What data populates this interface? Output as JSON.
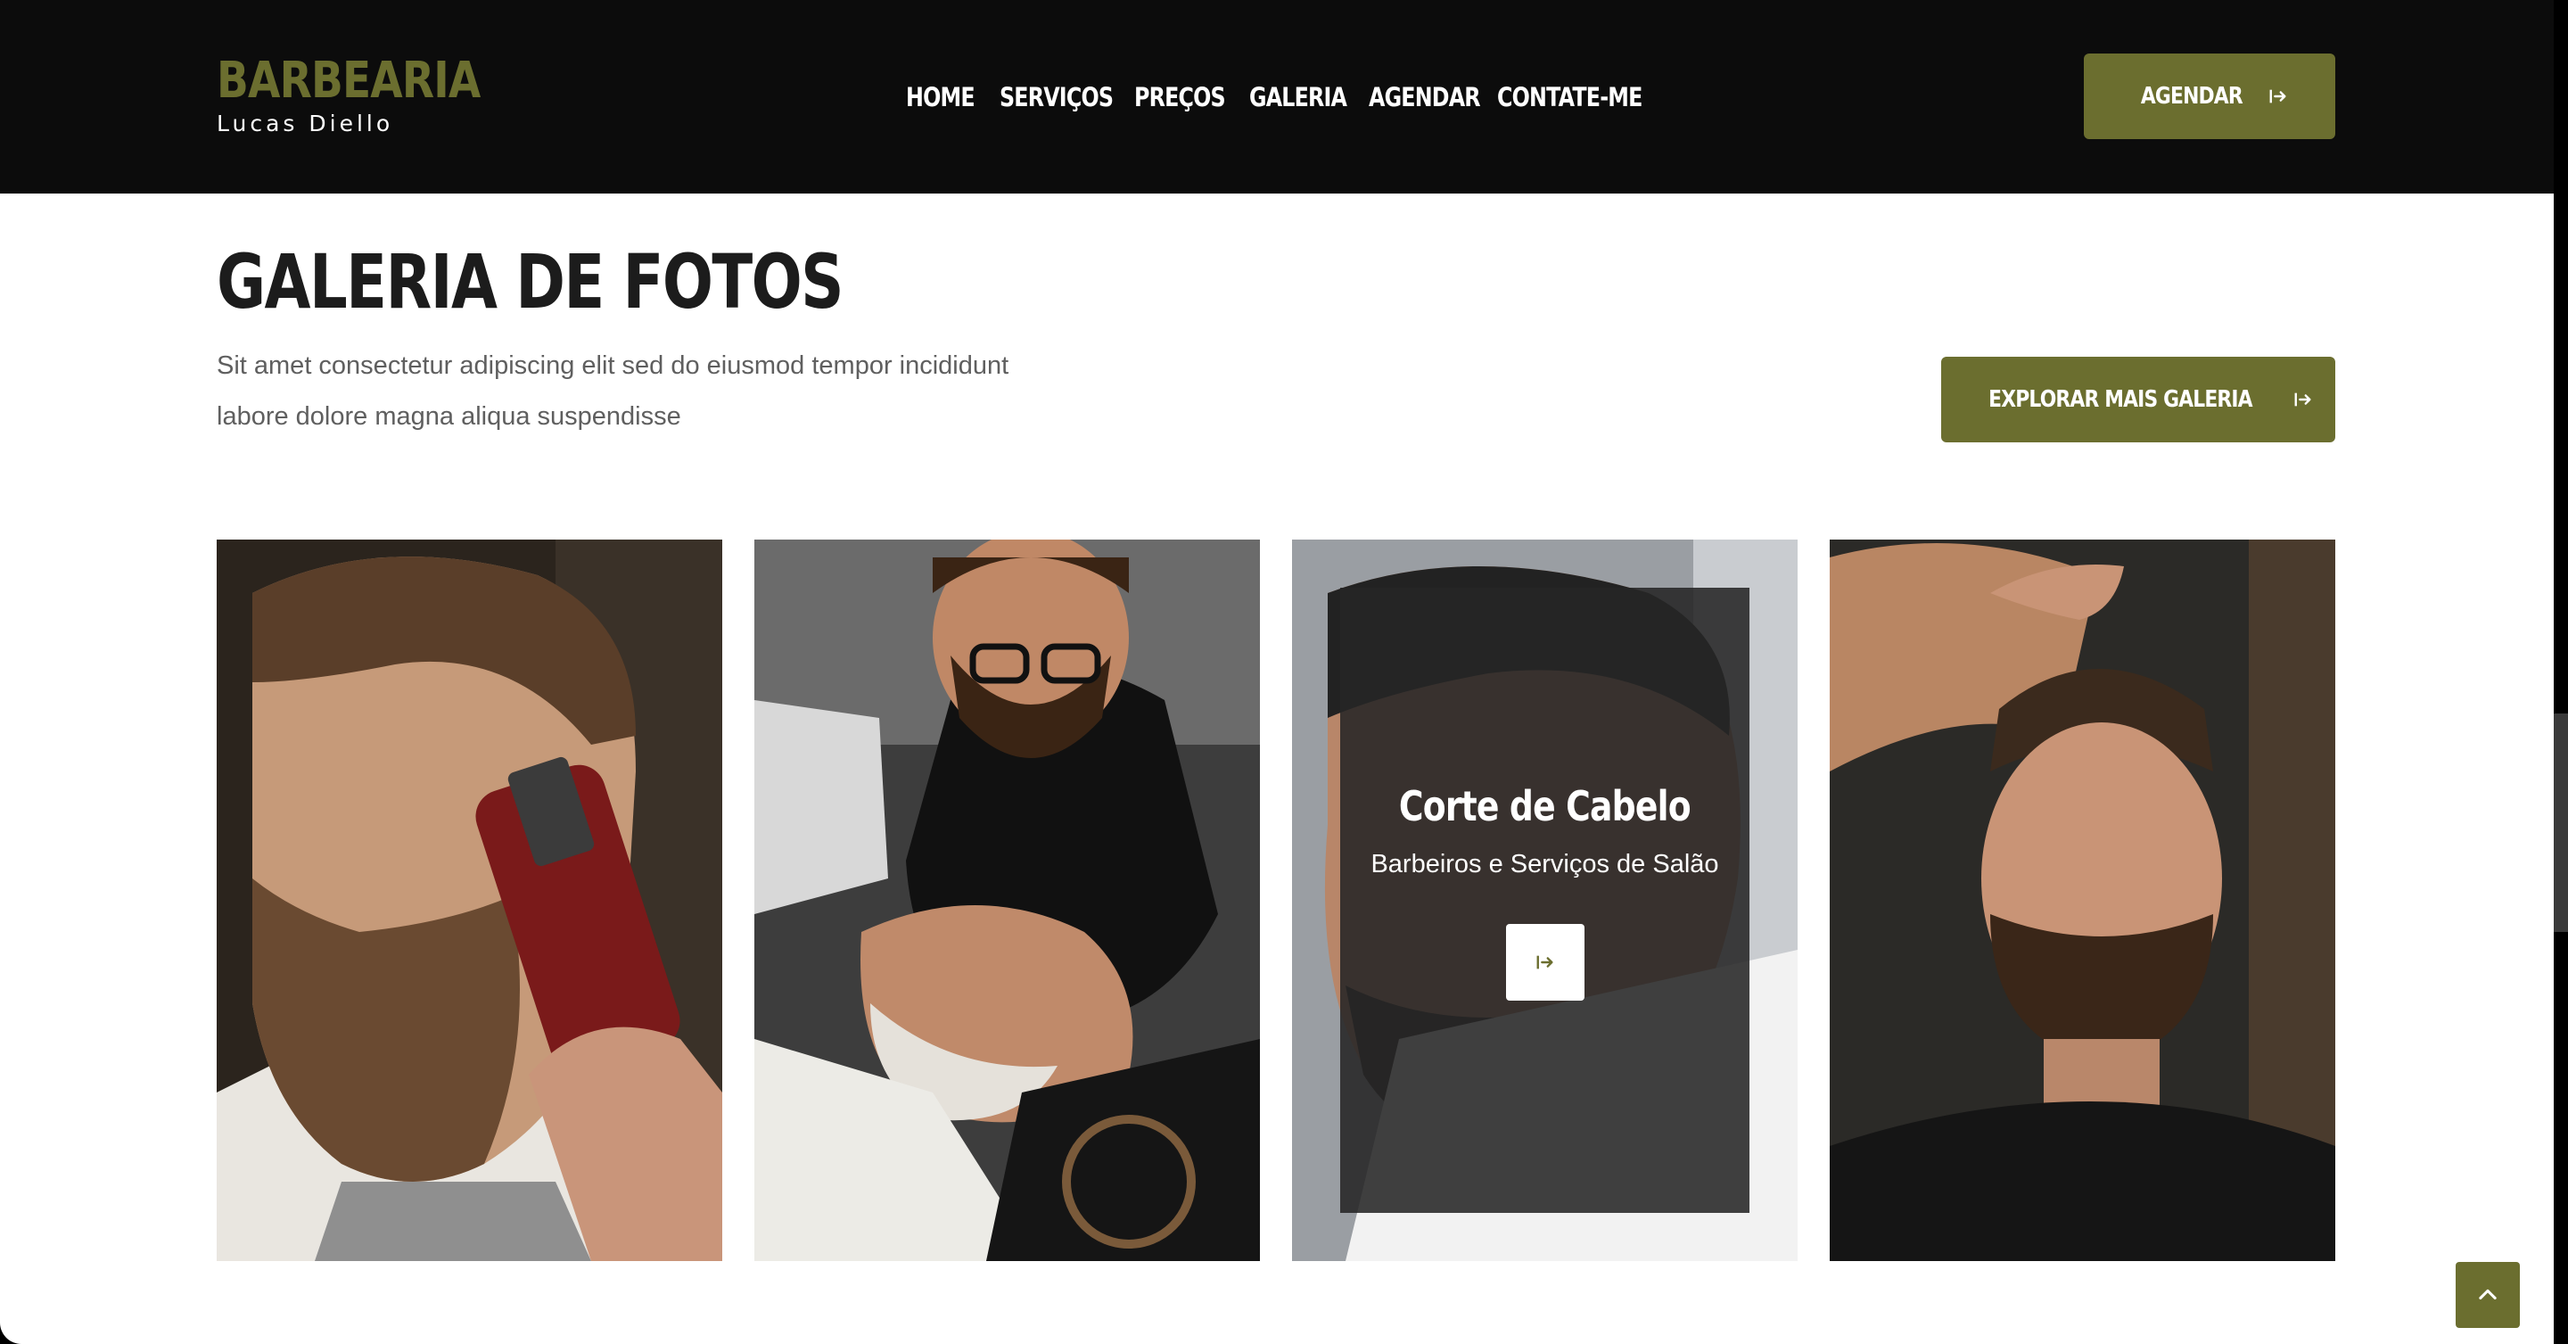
{
  "brand": {
    "name": "BARBEARIA",
    "subtitle": "Lucas Diello"
  },
  "nav": {
    "items": [
      "HOME",
      "SERVIÇOS",
      "PREÇOS",
      "GALERIA",
      "AGENDAR",
      "CONTATE-ME"
    ]
  },
  "header_button": {
    "label": "AGENDAR"
  },
  "gallery": {
    "title": "GALERIA DE FOTOS",
    "description": "Sit amet consectetur adipiscing elit sed do eiusmod tempor incididunt labore dolore magna aliqua suspendisse",
    "explore_button": "EXPLORAR MAIS GALERIA",
    "cards": [
      {
        "photo": "barber-trimming-beard"
      },
      {
        "photo": "barber-shaving-client"
      },
      {
        "photo": "haircut-side-view",
        "overlay_title": "Corte de Cabelo",
        "overlay_subtitle": "Barbeiros e Serviços de Salão"
      },
      {
        "photo": "hair-styling"
      }
    ]
  },
  "colors": {
    "accent": "#6b6e2f",
    "header_bg": "#0c0c0c",
    "title": "#1c1c1c",
    "text": "#5f5f5f"
  },
  "icons": {
    "button_arrow": "arrow-right-to-bar-icon",
    "back_to_top": "chevron-up-icon"
  }
}
